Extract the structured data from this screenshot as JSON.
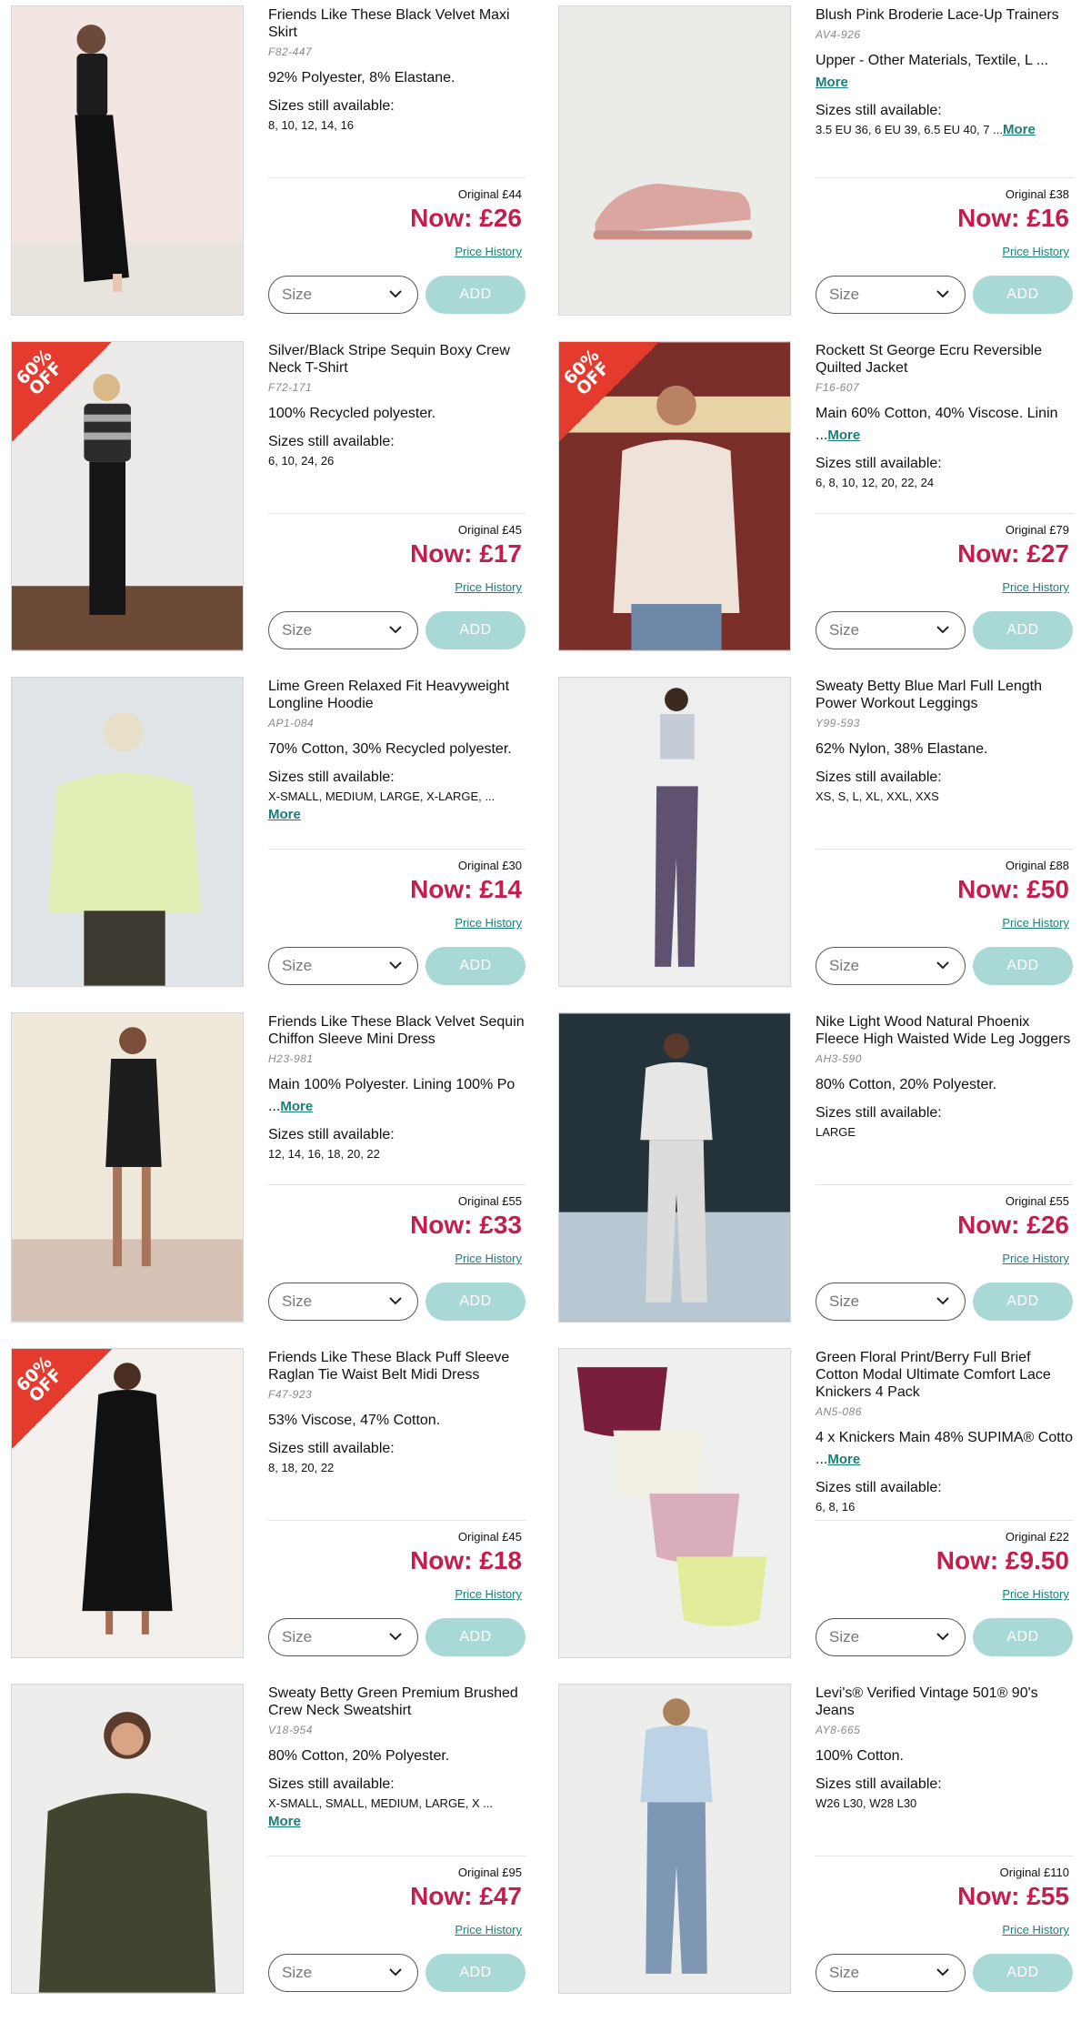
{
  "controls": {
    "size_placeholder": "Size",
    "add_label": "ADD",
    "price_history_label": "Price History",
    "sizes_label": "Sizes still available:",
    "more_label": "More",
    "accent_color": "#1a7f78",
    "sale_price_color": "#c41e4e",
    "add_button_color": "#a9d9d6",
    "badge_color": "#e53b2f"
  },
  "products": [
    {
      "title": "Friends Like These Black Velvet Maxi Skirt",
      "code": "F82-447",
      "material": "92% Polyester, 8% Elastane.",
      "material_more": "",
      "sizes": "8, 10, 12, 14, 16",
      "sizes_more": "",
      "original": "Original £44",
      "now": "Now: £26",
      "badge": ""
    },
    {
      "title": "Blush Pink Broderie Lace-Up Trainers",
      "code": "AV4-926",
      "material": "Upper - Other Materials, Textile, L ...",
      "material_more": "More",
      "sizes": "3.5 EU 36, 6 EU 39, 6.5 EU 40, 7 ...",
      "sizes_more": "More",
      "original": "Original £38",
      "now": "Now: £16",
      "badge": ""
    },
    {
      "title": "Silver/Black Stripe Sequin Boxy Crew Neck T-Shirt",
      "code": "F72-171",
      "material": "100% Recycled polyester.",
      "material_more": "",
      "sizes": "6, 10, 24, 26",
      "sizes_more": "",
      "original": "Original £45",
      "now": "Now: £17",
      "badge": "60% OFF"
    },
    {
      "title": "Rockett St George Ecru Reversible Quilted Jacket",
      "code": "F16-607",
      "material": "Main 60% Cotton, 40% Viscose. Linin ...",
      "material_more": "More",
      "sizes": "6, 8, 10, 12, 20, 22, 24",
      "sizes_more": "",
      "original": "Original £79",
      "now": "Now: £27",
      "badge": "60% OFF"
    },
    {
      "title": "Lime Green Relaxed Fit Heavyweight Longline Hoodie",
      "code": "AP1-084",
      "material": "70% Cotton, 30% Recycled polyester.",
      "material_more": "",
      "sizes": "X-SMALL, MEDIUM, LARGE, X-LARGE, ...",
      "sizes_more": "More",
      "original": "Original £30",
      "now": "Now: £14",
      "badge": ""
    },
    {
      "title": "Sweaty Betty Blue Marl Full Length Power Workout Leggings",
      "code": "Y99-593",
      "material": "62% Nylon, 38% Elastane.",
      "material_more": "",
      "sizes": "XS, S, L, XL, XXL, XXS",
      "sizes_more": "",
      "original": "Original £88",
      "now": "Now: £50",
      "badge": ""
    },
    {
      "title": "Friends Like These Black Velvet Sequin Chiffon Sleeve Mini Dress",
      "code": "H23-981",
      "material": "Main 100% Polyester. Lining 100% Po ...",
      "material_more": "More",
      "sizes": "12, 14, 16, 18, 20, 22",
      "sizes_more": "",
      "original": "Original £55",
      "now": "Now: £33",
      "badge": ""
    },
    {
      "title": "Nike Light Wood Natural Phoenix Fleece High Waisted Wide Leg Joggers",
      "code": "AH3-590",
      "material": "80% Cotton, 20% Polyester.",
      "material_more": "",
      "sizes": "LARGE",
      "sizes_more": "",
      "original": "Original £55",
      "now": "Now: £26",
      "badge": ""
    },
    {
      "title": "Friends Like These Black Puff Sleeve Raglan Tie Waist Belt Midi Dress",
      "code": "F47-923",
      "material": "53% Viscose, 47% Cotton.",
      "material_more": "",
      "sizes": "8, 18, 20, 22",
      "sizes_more": "",
      "original": "Original £45",
      "now": "Now: £18",
      "badge": "60% OFF"
    },
    {
      "title": "Green Floral Print/Berry Full Brief Cotton Modal Ultimate Comfort Lace Knickers 4 Pack",
      "code": "AN5-086",
      "material": "4 x Knickers Main 48% SUPIMA® Cotto ...",
      "material_more": "More",
      "sizes": "6, 8, 16",
      "sizes_more": "",
      "original": "Original £22",
      "now": "Now: £9.50",
      "badge": ""
    },
    {
      "title": "Sweaty Betty Green Premium Brushed Crew Neck Sweatshirt",
      "code": "V18-954",
      "material": "80% Cotton, 20% Polyester.",
      "material_more": "",
      "sizes": "X-SMALL, SMALL, MEDIUM, LARGE, X ...",
      "sizes_more": "More",
      "original": "Original £95",
      "now": "Now: £47",
      "badge": ""
    },
    {
      "title": "Levi's® Verified Vintage 501® 90's Jeans",
      "code": "AY8-665",
      "material": "100% Cotton.",
      "material_more": "",
      "sizes": "W26 L30, W28 L30",
      "sizes_more": "",
      "original": "Original £110",
      "now": "Now: £55",
      "badge": ""
    }
  ]
}
